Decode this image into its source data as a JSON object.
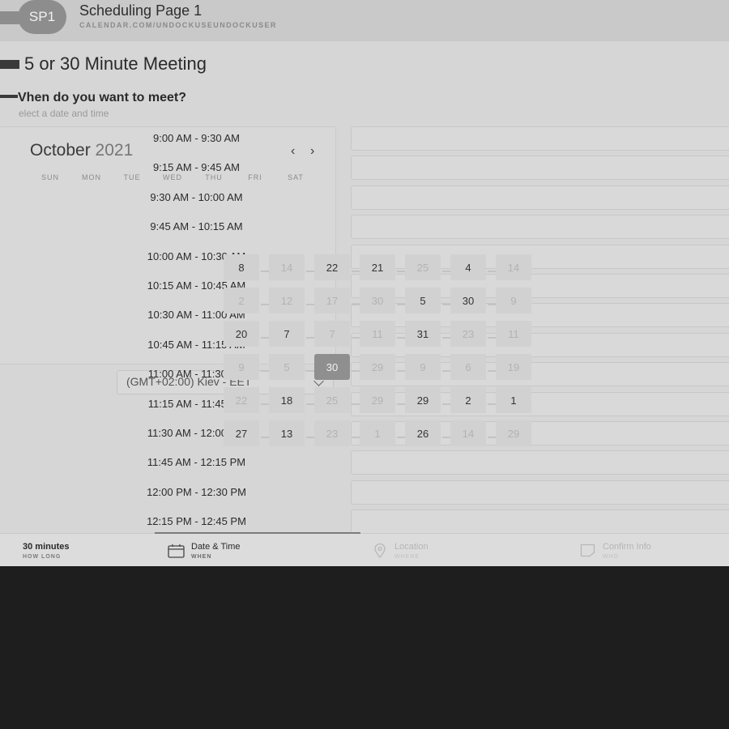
{
  "header": {
    "avatar_text": "SP1",
    "title": "Scheduling Page 1",
    "url": "CALENDAR.COM/UNDOCKUSEUNDOCKUSER"
  },
  "meeting": {
    "title": "5 or 30 Minute Meeting",
    "question": "Vhen do you want to meet?",
    "subtitle": "elect a date and time"
  },
  "calendar": {
    "month": "October",
    "year": "2021",
    "prev": "‹",
    "next": "›",
    "weekdays": [
      "SUN",
      "MON",
      "TUE",
      "WED",
      "THU",
      "FRI",
      "SAT"
    ],
    "overlay_cells": [
      {
        "text": "8",
        "style": "dark"
      },
      {
        "text": "14",
        "style": "faint"
      },
      {
        "text": "22",
        "style": "dark"
      },
      {
        "text": "21",
        "style": "dark"
      },
      {
        "text": "25",
        "style": "faint"
      },
      {
        "text": "4",
        "style": "dark"
      },
      {
        "text": "14",
        "style": "faint"
      },
      {
        "text": "2",
        "style": "faint"
      },
      {
        "text": "12",
        "style": "faint"
      },
      {
        "text": "17",
        "style": "faint"
      },
      {
        "text": "30",
        "style": "faint"
      },
      {
        "text": "5",
        "style": "dark"
      },
      {
        "text": "30",
        "style": "dark"
      },
      {
        "text": "9",
        "style": "faint"
      },
      {
        "text": "20",
        "style": "dark"
      },
      {
        "text": "7",
        "style": "dark"
      },
      {
        "text": "7",
        "style": "faint"
      },
      {
        "text": "11",
        "style": "faint"
      },
      {
        "text": "31",
        "style": "dark"
      },
      {
        "text": "23",
        "style": "faint"
      },
      {
        "text": "11",
        "style": "faint"
      },
      {
        "text": "9",
        "style": "faint"
      },
      {
        "text": "5",
        "style": "faint"
      },
      {
        "text": "30",
        "style": "selected"
      },
      {
        "text": "29",
        "style": "faint"
      },
      {
        "text": "9",
        "style": "faint"
      },
      {
        "text": "6",
        "style": "faint"
      },
      {
        "text": "19",
        "style": "faint"
      },
      {
        "text": "22",
        "style": "faint"
      },
      {
        "text": "18",
        "style": "dark"
      },
      {
        "text": "25",
        "style": "faint"
      },
      {
        "text": "29",
        "style": "faint"
      },
      {
        "text": "29",
        "style": "dark"
      },
      {
        "text": "2",
        "style": "dark"
      },
      {
        "text": "1",
        "style": "dark"
      },
      {
        "text": "27",
        "style": "dark"
      },
      {
        "text": "13",
        "style": "dark"
      },
      {
        "text": "23",
        "style": "faint"
      },
      {
        "text": "1",
        "style": "faint"
      },
      {
        "text": "26",
        "style": "dark"
      },
      {
        "text": "14",
        "style": "faint"
      },
      {
        "text": "29",
        "style": "faint"
      }
    ]
  },
  "timezone": {
    "value": "(GMT+02:00) Kiev - EET"
  },
  "time_slots": [
    "9:00 AM - 9:30 AM",
    "9:15 AM - 9:45 AM",
    "9:30 AM - 10:00 AM",
    "9:45 AM - 10:15 AM",
    "10:00 AM - 10:30 AM",
    "10:15 AM - 10:45 AM",
    "10:30 AM - 11:00 AM",
    "10:45 AM - 11:15 AM",
    "11:00 AM - 11:30 AM",
    "11:15 AM - 11:45 AM",
    "11:30 AM - 12:00 PM",
    "11:45 AM - 12:15 PM",
    "12:00 PM - 12:30 PM",
    "12:15 PM - 12:45 PM"
  ],
  "footer": {
    "steps": [
      {
        "title": "30 minutes",
        "sub": "HOW LONG",
        "state": "done"
      },
      {
        "title": "Date & Time",
        "sub": "WHEN",
        "state": "active",
        "icon": "calendar-icon"
      },
      {
        "title": "Location",
        "sub": "WHERE",
        "state": "disabled",
        "icon": "map-pin-icon"
      },
      {
        "title": "Confirm Info",
        "sub": "WHO",
        "state": "disabled",
        "icon": "note-icon"
      }
    ]
  },
  "colors": {
    "canvas": "#d6d6d6",
    "header": "#c9c9c9",
    "selected_day": "#8f8f8f",
    "letterbox": "#1e1e1e"
  }
}
